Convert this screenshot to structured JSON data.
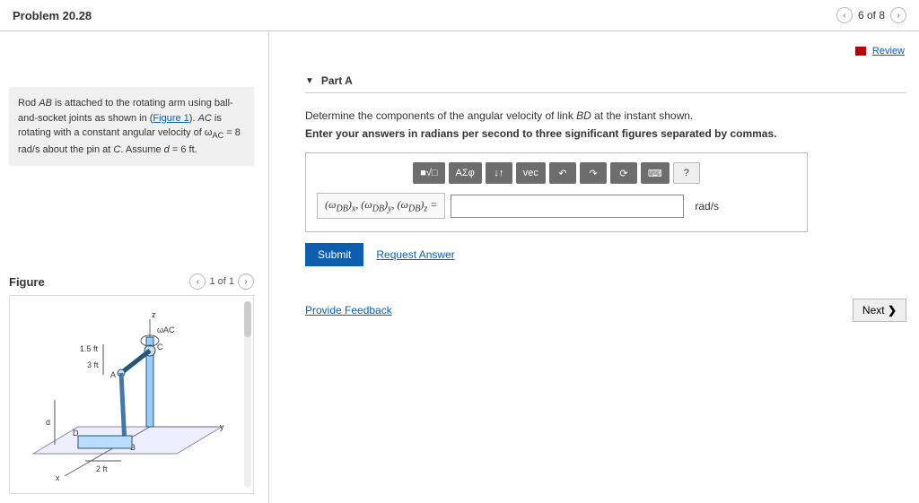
{
  "header": {
    "title": "Problem 20.28",
    "position": "6 of 8"
  },
  "review_label": "Review",
  "problem_statement_html": "Rod <i>AB</i> is attached to the rotating arm using ball-and-socket joints as shown in (<a href='#'>Figure 1</a>). <i>AC</i> is rotating with a constant angular velocity of ω<sub>AC</sub> = 8 rad/s about the pin at <i>C</i>. Assume <i>d</i> = 6 ft.",
  "figure": {
    "title": "Figure",
    "position": "1 of 1",
    "labels": {
      "omega": "ωAC",
      "h1": "1.5 ft",
      "h2": "3 ft",
      "d": "d",
      "base": "2 ft",
      "A": "A",
      "B": "B",
      "C": "C",
      "D": "D",
      "z": "z",
      "y": "y",
      "x": "x"
    }
  },
  "part": {
    "label": "Part A",
    "question_html": "Determine the components of the angular velocity of link <i>BD</i> at the instant shown.",
    "instruction": "Enter your answers in radians per second to three significant figures separated by commas.",
    "lhs": "(ω_DB)_x, (ω_DB)_y, (ω_DB)_z =",
    "unit": "rad/s",
    "input_value": ""
  },
  "toolbar": {
    "templates": "■√□",
    "symbols": "ΑΣφ",
    "scripts": "↓↑",
    "vec": "vec",
    "undo": "↶",
    "redo": "↷",
    "reset": "⟳",
    "keyboard": "⌨",
    "help": "?"
  },
  "actions": {
    "submit": "Submit",
    "request_answer": "Request Answer",
    "provide_feedback": "Provide Feedback",
    "next": "Next"
  }
}
